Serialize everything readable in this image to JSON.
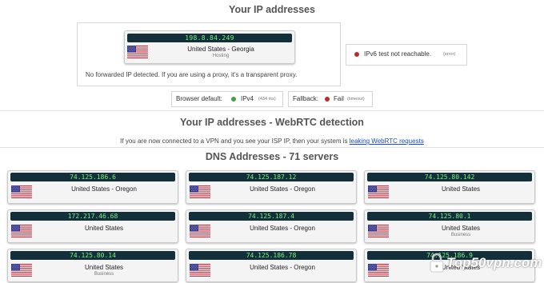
{
  "header": {
    "title": "Your IP addresses"
  },
  "ip_card": {
    "ip": "198.8.84.249",
    "location": "United States - Georgia",
    "type": "Hosting"
  },
  "proxy_note": "No forwarded IP detected. If you are using a proxy, it's a transparent proxy.",
  "ipv6": {
    "text": "IPv6 test not reachable.",
    "tag": "(error)",
    "status_color": "#c62828"
  },
  "browser_default": {
    "label": "Browser default:",
    "value": "IPv4",
    "timing": "(434 ms)",
    "status_color": "#43a047"
  },
  "fallback": {
    "label": "Fallback:",
    "value": "Fail",
    "timing": "(timeout)",
    "status_color": "#c62828"
  },
  "webrtc": {
    "title": "Your IP addresses - WebRTC detection",
    "note_prefix": "If you are now connected to a VPN and you see your ISP IP, then your system is",
    "link": "leaking WebRTC requests"
  },
  "dns": {
    "title": "DNS Addresses - 71 servers",
    "servers": [
      {
        "ip": "74.125.186.6",
        "location": "United States - Oregon",
        "sub": ""
      },
      {
        "ip": "74.125.187.12",
        "location": "United States - Oregon",
        "sub": ""
      },
      {
        "ip": "74.125.80.142",
        "location": "United States",
        "sub": ""
      },
      {
        "ip": "172.217.46.68",
        "location": "United States",
        "sub": ""
      },
      {
        "ip": "74.125.187.4",
        "location": "United States - Oregon",
        "sub": ""
      },
      {
        "ip": "74.125.80.1",
        "location": "United States",
        "sub": "Business"
      },
      {
        "ip": "74.125.80.14",
        "location": "United States",
        "sub": "Business"
      },
      {
        "ip": "74.125.186.78",
        "location": "United States - Oregon",
        "sub": ""
      },
      {
        "ip": "74.125.186.9",
        "location": "United States",
        "sub": ""
      }
    ]
  },
  "watermark": {
    "brand": "Top50vpn.com",
    "icon": "lock-icon"
  },
  "colors": {
    "ip_bar_bg": "#13303a",
    "ip_text": "#79f07a",
    "link": "#1a4cc4"
  }
}
